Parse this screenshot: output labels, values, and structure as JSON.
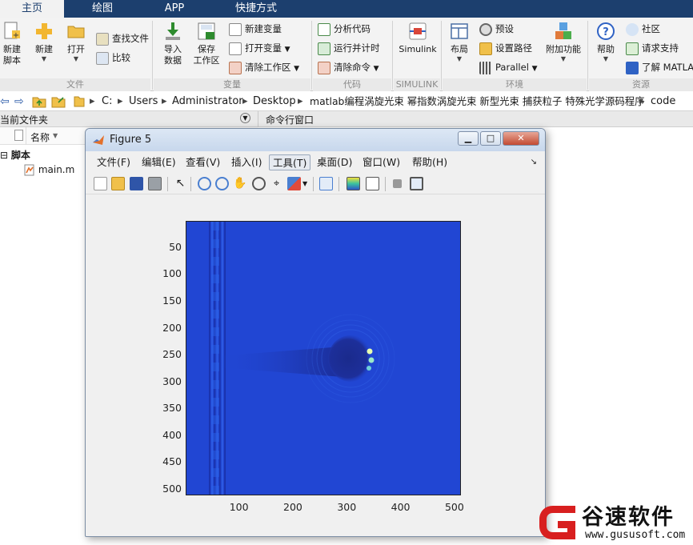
{
  "tabs": [
    "主页",
    "绘图",
    "APP",
    "快捷方式"
  ],
  "ribbon": {
    "file": {
      "new_script": "新建\n脚本",
      "new": "新建",
      "open": "打开",
      "find_files": "查找文件",
      "compare": "比较",
      "label": "文件"
    },
    "variable": {
      "import": "导入\n数据",
      "save_ws": "保存\n工作区",
      "new_var": "新建变量",
      "open_var": "打开变量",
      "clear_ws": "清除工作区",
      "label": "变量"
    },
    "code": {
      "analyze": "分析代码",
      "run_time": "运行并计时",
      "clear_cmd": "清除命令",
      "label": "代码"
    },
    "simulink": {
      "btn": "Simulink",
      "label": "SIMULINK"
    },
    "env": {
      "layout": "布局",
      "prefs": "预设",
      "set_path": "设置路径",
      "parallel": "Parallel",
      "addons": "附加功能",
      "label": "环境"
    },
    "resources": {
      "help": "帮助",
      "community": "社区",
      "support": "请求支持",
      "learn": "了解 MATLA",
      "label": "资源"
    }
  },
  "address": [
    "C:",
    "Users",
    "Administrator",
    "Desktop",
    "matlab编程涡旋光束 幂指数涡旋光束 新型光束 捕获粒子 特殊光学源码程序",
    "code"
  ],
  "panes": {
    "current_folder": "当前文件夹",
    "command_window": "命令行窗口"
  },
  "files": {
    "col_name": "名称",
    "group": "脚本",
    "items": [
      "main.m"
    ]
  },
  "figure": {
    "title": "Figure 5",
    "menu": [
      "文件(F)",
      "编辑(E)",
      "查看(V)",
      "插入(I)",
      "工具(T)",
      "桌面(D)",
      "窗口(W)",
      "帮助(H)"
    ],
    "selected_menu": "工具(T)"
  },
  "chart_data": {
    "type": "heatmap",
    "title": "",
    "xlabel": "",
    "ylabel": "",
    "xlim": [
      1,
      512
    ],
    "ylim": [
      1,
      512
    ],
    "y_reversed": true,
    "xticks": [
      100,
      200,
      300,
      400,
      500
    ],
    "yticks": [
      50,
      100,
      150,
      200,
      250,
      300,
      350,
      400,
      450,
      500
    ],
    "colormap": "parula",
    "background_level": 0.18
  },
  "watermark": {
    "name": "谷速软件",
    "url": "www.gususoft.com"
  },
  "colors": {
    "tab_bar": "#1c3f6e",
    "plot_bg": "#2146d3",
    "beam": "#1a2a8c",
    "hot": "#e8ffb0",
    "wm_red": "#d81f1f"
  }
}
